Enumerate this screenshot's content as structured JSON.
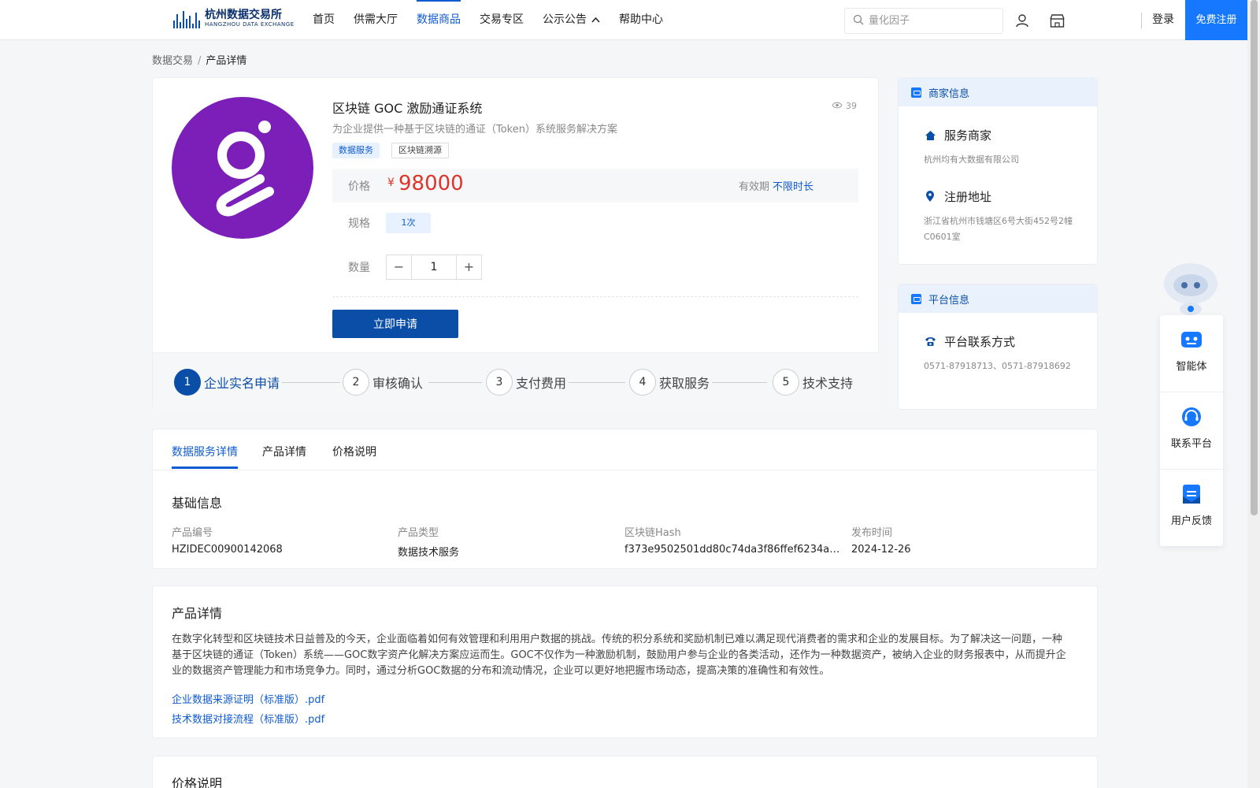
{
  "header": {
    "logo_cn": "杭州数据交易所",
    "logo_en": "HANGZHOU DATA EXCHANGE",
    "nav": [
      "首页",
      "供需大厅",
      "数据商品",
      "交易专区",
      "公示公告",
      "帮助中心"
    ],
    "active_nav": "数据商品",
    "search_placeholder": "量化因子",
    "login": "登录",
    "register": "免费注册"
  },
  "breadcrumb": {
    "root": "数据交易",
    "sep": "/",
    "current": "产品详情"
  },
  "product": {
    "title": "区块链 GOC 激励通证系统",
    "views": "39",
    "subtitle": "为企业提供一种基于区块链的通证（Token）系统服务解决方案",
    "tags": [
      "数据服务",
      "区块链溯源"
    ],
    "price_label": "价格",
    "currency": "¥",
    "price": "98000",
    "validity_label": "有效期",
    "validity_value": "不限时长",
    "spec_label": "规格",
    "spec_value": "1次",
    "qty_label": "数量",
    "qty_value": "1",
    "qty_minus": "−",
    "qty_plus": "+",
    "apply_button": "立即申请"
  },
  "steps": [
    {
      "num": "1",
      "label": "企业实名申请"
    },
    {
      "num": "2",
      "label": "审核确认"
    },
    {
      "num": "3",
      "label": "支付费用"
    },
    {
      "num": "4",
      "label": "获取服务"
    },
    {
      "num": "5",
      "label": "技术支持"
    }
  ],
  "merchant": {
    "header": "商家信息",
    "service_label": "服务商家",
    "service_value": "杭州均有大数据有限公司",
    "address_label": "注册地址",
    "address_value": "浙江省杭州市钱塘区6号大街452号2幢C0601室"
  },
  "platform": {
    "header": "平台信息",
    "contact_label": "平台联系方式",
    "contact_value": "0571-87918713、0571-87918692"
  },
  "tabs": [
    "数据服务详情",
    "产品详情",
    "价格说明"
  ],
  "basic_info": {
    "title": "基础信息",
    "fields": [
      {
        "k": "产品编号",
        "v": "HZIDEC00900142068"
      },
      {
        "k": "产品类型",
        "v": "数据技术服务"
      },
      {
        "k": "区块链Hash",
        "v": "f373e9502501dd80c74da3f86ffef6234a4b…"
      },
      {
        "k": "发布时间",
        "v": "2024-12-26"
      }
    ]
  },
  "product_detail": {
    "title": "产品详情",
    "text": "在数字化转型和区块链技术日益普及的今天，企业面临着如何有效管理和利用用户数据的挑战。传统的积分系统和奖励机制已难以满足现代消费者的需求和企业的发展目标。为了解决这一问题，一种基于区块链的通证（Token）系统——GOC数字资产化解决方案应运而生。GOC不仅作为一种激励机制，鼓励用户参与企业的各类活动，还作为一种数据资产，被纳入企业的财务报表中，从而提升企业的数据资产管理能力和市场竞争力。同时，通过分析GOC数据的分布和流动情况，企业可以更好地把握市场动态，提高决策的准确性和有效性。",
    "files": [
      "企业数据来源证明（标准版）.pdf",
      "技术数据对接流程（标准版）.pdf"
    ]
  },
  "price_section": {
    "title": "价格说明"
  },
  "float_menu": [
    "智能体",
    "联系平台",
    "用户反馈"
  ]
}
